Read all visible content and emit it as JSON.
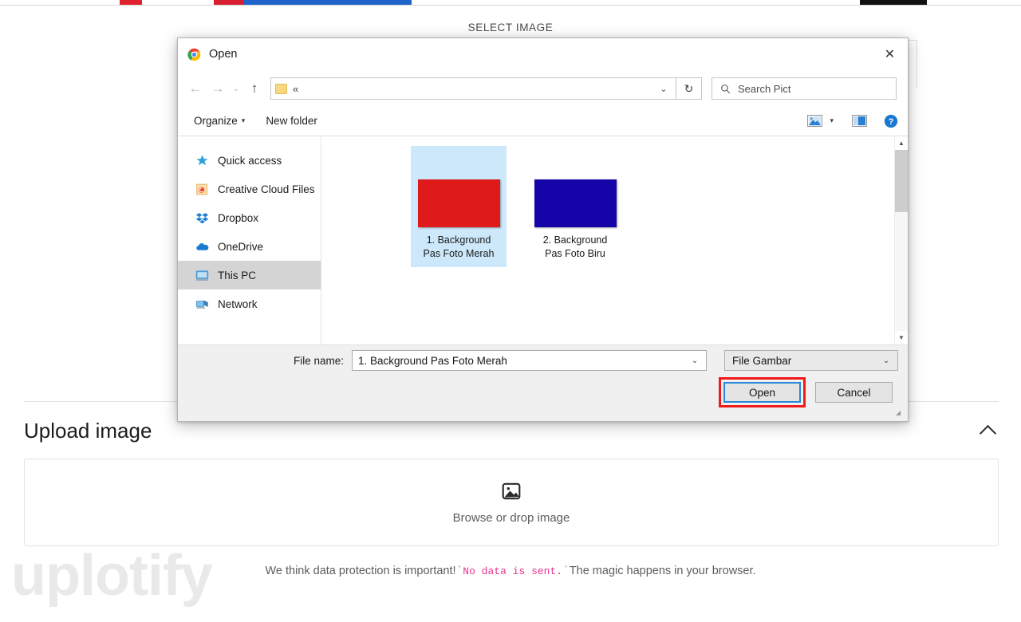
{
  "page": {
    "select_image_label": "SELECT IMAGE",
    "upload_title": "Upload image",
    "dropzone_label": "Browse or drop image",
    "watermark": "uplotify",
    "footer": {
      "part1": "We think data protection is important!",
      "tick_open": "`",
      "mono": "No data is sent.",
      "tick_close": "`",
      "part2": "The magic happens in your browser."
    }
  },
  "dialog": {
    "title": "Open",
    "close_label": "✕",
    "nav": {
      "back_label": "←",
      "forward_label": "→",
      "history_label": "⌄",
      "up_label": "↑",
      "address_path": "«",
      "address_caret": "⌄",
      "refresh_label": "↻"
    },
    "search": {
      "placeholder": "Search Pict"
    },
    "commands": {
      "organize": "Organize",
      "organize_caret": "▾",
      "new_folder": "New folder",
      "view_caret": "▾",
      "help_label": "?"
    },
    "sidebar": {
      "items": [
        {
          "label": "Quick access",
          "icon": "star-icon",
          "selected": false
        },
        {
          "label": "Creative Cloud Files",
          "icon": "creative-cloud-icon",
          "selected": false
        },
        {
          "label": "Dropbox",
          "icon": "dropbox-icon",
          "selected": false
        },
        {
          "label": "OneDrive",
          "icon": "onedrive-icon",
          "selected": false
        },
        {
          "label": "This PC",
          "icon": "this-pc-icon",
          "selected": true
        },
        {
          "label": "Network",
          "icon": "network-icon",
          "selected": false
        }
      ]
    },
    "files": [
      {
        "name_line1": "1. Background",
        "name_line2": "Pas Foto Merah",
        "color": "#de1a1a",
        "selected": true
      },
      {
        "name_line1": "2. Background",
        "name_line2": "Pas Foto Biru",
        "color": "#1505a8",
        "selected": false
      }
    ],
    "scrollbar": {
      "up_label": "▲",
      "down_label": "▼"
    },
    "bottom": {
      "filename_label": "File name:",
      "filename_value": "1. Background Pas Foto Merah",
      "filename_caret": "⌄",
      "filter_value": "File Gambar",
      "filter_caret": "⌄",
      "open_label": "Open",
      "cancel_label": "Cancel"
    }
  },
  "colors": {
    "annotation_red": "#f21b1b",
    "focus_blue": "#2a86d8",
    "selection_blue": "#cde8fa",
    "thumb_red": "#de1a1a",
    "thumb_blue": "#1505a8",
    "mono_pink": "#e8338f"
  }
}
